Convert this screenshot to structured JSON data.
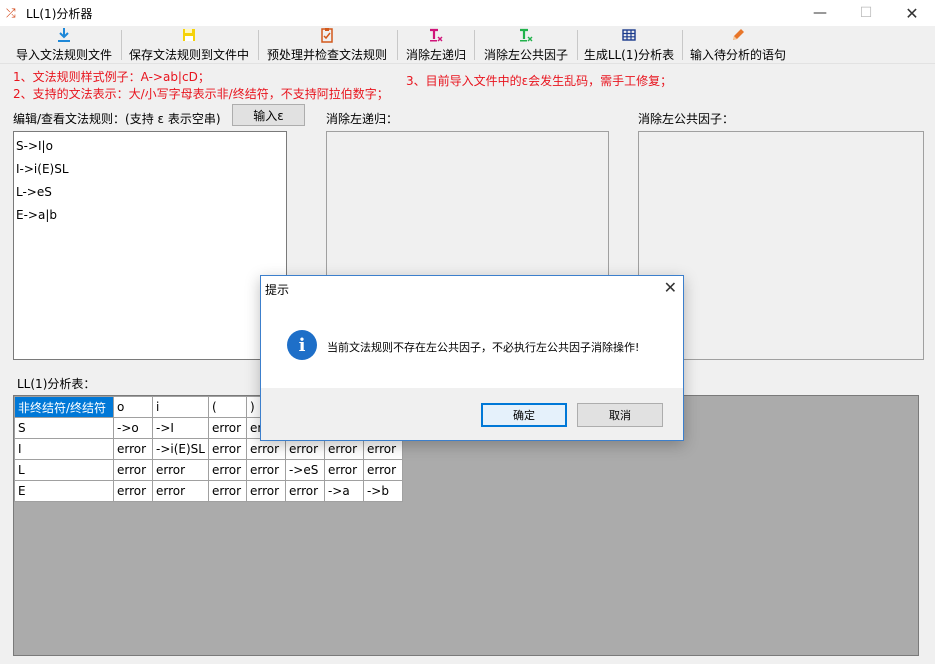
{
  "window": {
    "title": "LL(1)分析器",
    "min_label": "—",
    "max_label": "☐",
    "close_label": "✕"
  },
  "toolbar": {
    "items": [
      {
        "label": "导入文法规则文件",
        "icon": "download-icon"
      },
      {
        "label": "保存文法规则到文件中",
        "icon": "save-icon"
      },
      {
        "label": "预处理并检查文法规则",
        "icon": "checklist-icon"
      },
      {
        "label": "消除左递归",
        "icon": "clear-format-icon"
      },
      {
        "label": "消除左公共因子",
        "icon": "clear-format-green-icon"
      },
      {
        "label": "生成LL(1)分析表",
        "icon": "table-icon"
      },
      {
        "label": "输入待分析的语句",
        "icon": "pencil-icon"
      }
    ]
  },
  "notes": {
    "line1": "1、文法规则样式例子：A->ab|cD；",
    "line2": "2、支持的文法表示：大/小写字母表示非/终结符，不支持阿拉伯数字；",
    "line3": "3、目前导入文件中的ε会发生乱码，需手工修复；"
  },
  "editor": {
    "label": "编辑/查看文法规则：(支持 ε 表示空串)",
    "epsilon_button": "输入ε",
    "rules": [
      "S->I|o",
      "I->i(E)SL",
      "L->eS",
      "E->a|b"
    ]
  },
  "left_recursion": {
    "label": "消除左递归："
  },
  "left_factor": {
    "label": "消除左公共因子："
  },
  "table": {
    "label": "LL(1)分析表：",
    "header": [
      "非终结符/终结符",
      "o",
      "i",
      "(",
      ")",
      "",
      "",
      ""
    ],
    "rows": [
      [
        "S",
        "->o",
        "->I",
        "error",
        "error",
        "",
        "",
        ""
      ],
      [
        "I",
        "error",
        "->i(E)SL",
        "error",
        "error",
        "error",
        "error",
        "error"
      ],
      [
        "L",
        "error",
        "error",
        "error",
        "error",
        "->eS",
        "error",
        "error"
      ],
      [
        "E",
        "error",
        "error",
        "error",
        "error",
        "error",
        "->a",
        "->b"
      ]
    ]
  },
  "dialog": {
    "title": "提示",
    "message": "当前文法规则不存在左公共因子，不必执行左公共因子消除操作!",
    "ok_label": "确定",
    "cancel_label": "取消",
    "icon": "info-icon"
  },
  "colors": {
    "note_red": "#e8141e",
    "selection_blue": "#0078d7",
    "grid_background": "#ababab"
  }
}
